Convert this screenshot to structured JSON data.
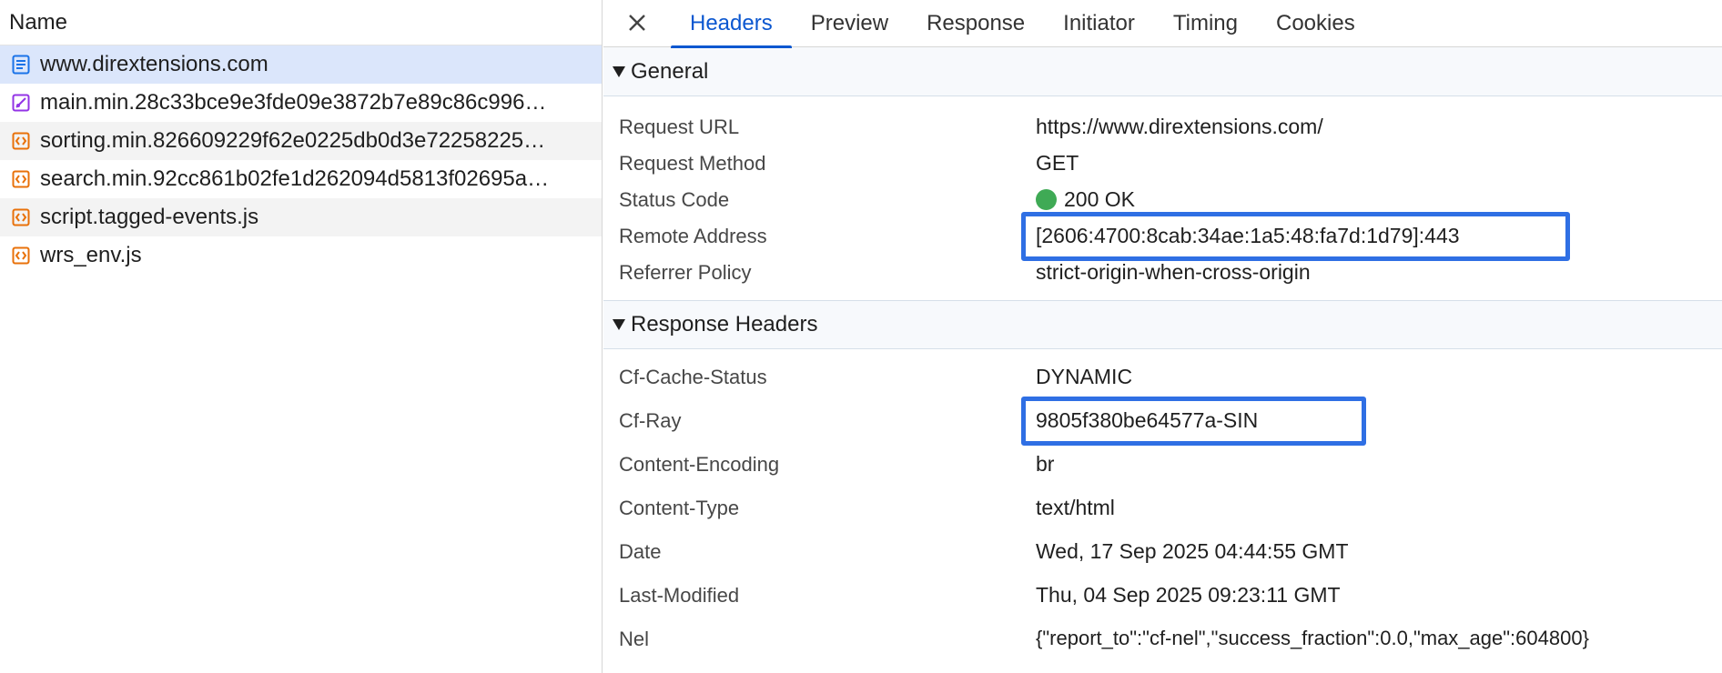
{
  "left": {
    "header": "Name",
    "rows": [
      {
        "name": "www.dirextensions.com",
        "icon": "document-icon",
        "selected": true
      },
      {
        "name": "main.min.28c33bce9e3fde09e3872b7e89c86c996…",
        "icon": "stylesheet-icon"
      },
      {
        "name": "sorting.min.826609229f62e0225db0d3e72258225…",
        "icon": "script-icon"
      },
      {
        "name": "search.min.92cc861b02fe1d262094d5813f02695a…",
        "icon": "script-icon"
      },
      {
        "name": "script.tagged-events.js",
        "icon": "script-icon"
      },
      {
        "name": "wrs_env.js",
        "icon": "script-icon"
      }
    ]
  },
  "tabs": [
    "Headers",
    "Preview",
    "Response",
    "Initiator",
    "Timing",
    "Cookies"
  ],
  "active_tab": "Headers",
  "general": {
    "title": "General",
    "rows": [
      {
        "k": "Request URL",
        "v": "https://www.dirextensions.com/"
      },
      {
        "k": "Request Method",
        "v": "GET"
      },
      {
        "k": "Status Code",
        "v": "200 OK"
      },
      {
        "k": "Remote Address",
        "v": "[2606:4700:8cab:34ae:1a5:48:fa7d:1d79]:443"
      },
      {
        "k": "Referrer Policy",
        "v": "strict-origin-when-cross-origin"
      }
    ]
  },
  "response_headers": {
    "title": "Response Headers",
    "rows": [
      {
        "k": "Cf-Cache-Status",
        "v": "DYNAMIC"
      },
      {
        "k": "Cf-Ray",
        "v": "9805f380be64577a-SIN"
      },
      {
        "k": "Content-Encoding",
        "v": "br"
      },
      {
        "k": "Content-Type",
        "v": "text/html"
      },
      {
        "k": "Date",
        "v": "Wed, 17 Sep 2025 04:44:55 GMT"
      },
      {
        "k": "Last-Modified",
        "v": "Thu, 04 Sep 2025 09:23:11 GMT"
      },
      {
        "k": "Nel",
        "v": "{\"report_to\":\"cf-nel\",\"success_fraction\":0.0,\"max_age\":604800}"
      }
    ]
  },
  "colors": {
    "accent": "#0b57d0",
    "highlight": "#2f6fe4",
    "status_ok": "#3faa55"
  }
}
